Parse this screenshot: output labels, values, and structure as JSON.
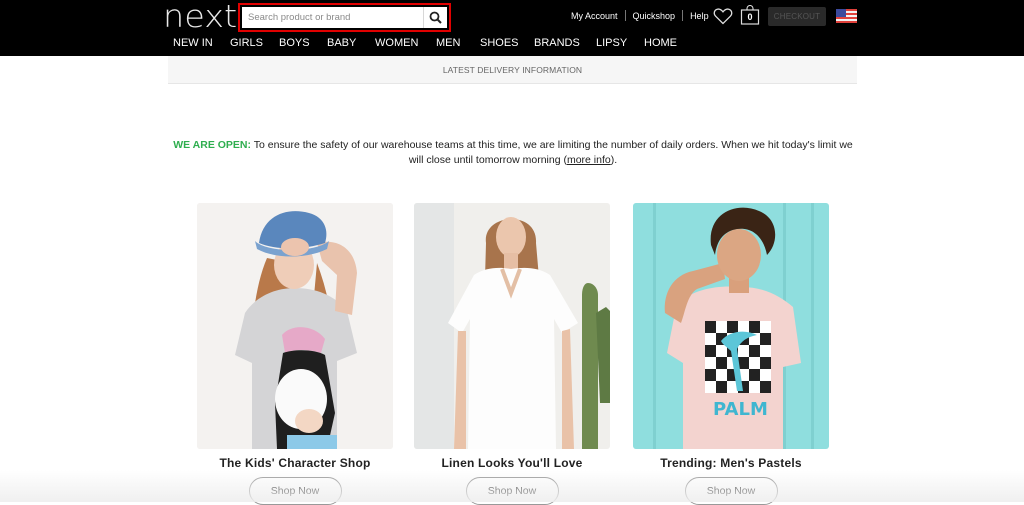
{
  "header": {
    "logo": "next",
    "search": {
      "placeholder": "Search product or brand",
      "value": ""
    },
    "utility_links": [
      "My Account",
      "Quickshop",
      "Help"
    ],
    "bag_count": "0",
    "checkout_label": "CHECKOUT",
    "country": "United States"
  },
  "nav": [
    "NEW IN",
    "GIRLS",
    "BOYS",
    "BABY",
    "WOMEN",
    "MEN",
    "SHOES",
    "BRANDS",
    "LIPSY",
    "HOME"
  ],
  "delivery_bar": "LATEST DELIVERY INFORMATION",
  "notice": {
    "highlight": "WE ARE OPEN:",
    "text": " To ensure the safety of our warehouse teams at this time, we are limiting the number of daily orders. When we hit today's limit we will close until tomorrow morning (",
    "link": "more info",
    "tail": ")."
  },
  "promos": [
    {
      "title": "The Kids' Character Shop",
      "button": "Shop Now"
    },
    {
      "title": "Linen Looks You'll Love",
      "button": "Shop Now"
    },
    {
      "title": "Trending: Men's Pastels",
      "button": "Shop Now"
    }
  ],
  "colors": {
    "accent_red": "#e10000",
    "open_green": "#2fae4f",
    "header_bg": "#000000"
  }
}
